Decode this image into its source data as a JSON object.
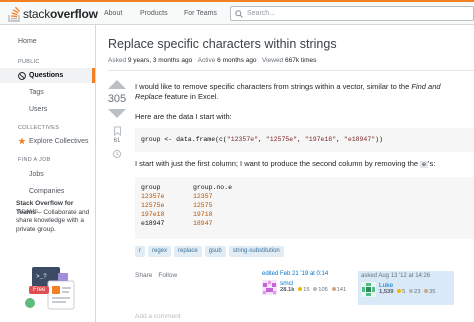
{
  "topbar": {
    "logo_text_plain": "stack",
    "logo_text_bold": "overflow",
    "nav": [
      "About",
      "Products",
      "For Teams"
    ],
    "search_placeholder": "Search..."
  },
  "sidebar": {
    "home": "Home",
    "public_label": "PUBLIC",
    "questions": "Questions",
    "tags": "Tags",
    "users": "Users",
    "collectives_label": "COLLECTIVES",
    "explore_collectives": "Explore Collectives",
    "find_job_label": "FIND A JOB",
    "jobs": "Jobs",
    "companies": "Companies",
    "teams_label": "TEAMS",
    "teams_title": "Stack Overflow for Teams",
    "teams_desc": " – Collaborate and share knowledge with a private group.",
    "free_badge": "Free"
  },
  "question": {
    "title": "Replace specific characters within strings",
    "asked_label": "Asked",
    "asked_value": "9 years, 3 months ago",
    "active_label": "Active",
    "active_value": "6 months ago",
    "viewed_label": "Viewed",
    "viewed_value": "667k times",
    "votes": "305",
    "bookmarks": "61",
    "para1_a": "I would like to remove specific characters from strings within a vector, similar to the ",
    "para1_em": "Find and Replace",
    "para1_b": " feature in Excel.",
    "para2": "Here are the data I start with:",
    "code1_a": "group <- data.frame(c(",
    "code1_s1": "\"12357e\"",
    "code1_s2": "\"12575e\"",
    "code1_s3": "\"197e18\"",
    "code1_s4": "\"e18947\"",
    "code1_b": "))",
    "para3_a": "I start with just the first column; I want to produce the second column by removing the ",
    "para3_code": "e",
    "para3_b": "'s:",
    "table_headers": [
      "group",
      "group.no.e"
    ],
    "table_rows": [
      [
        "12357e",
        "12357"
      ],
      [
        "12575e",
        "12575"
      ],
      [
        "197e18",
        "19718"
      ],
      [
        "e18947",
        "18947"
      ]
    ],
    "tags": [
      "r",
      "regex",
      "replace",
      "gsub",
      "string-substitution"
    ],
    "share": "Share",
    "follow": "Follow",
    "add_comment": "Add a comment"
  },
  "editor": {
    "time": "edited Feb 21 '19 at 0:14",
    "name": "smci",
    "rep": "28.1k",
    "gold": "15",
    "silver": "105",
    "bronze": "141"
  },
  "asker": {
    "time": "asked Aug 13 '12 at 14:26",
    "name": "Luke",
    "rep": "1,539",
    "gold": "5",
    "silver": "23",
    "bronze": "35"
  },
  "colors": {
    "accent": "#f48024",
    "link": "#0074cc",
    "tag_bg": "#e1ecf4",
    "tag_fg": "#39739d",
    "gold": "#f1b600",
    "silver": "#b4b8bc",
    "bronze": "#d1a684"
  },
  "icons": [
    "search-icon",
    "globe-icon",
    "star-icon",
    "bookmark-icon",
    "history-icon",
    "stack-overflow-logo-icon"
  ]
}
